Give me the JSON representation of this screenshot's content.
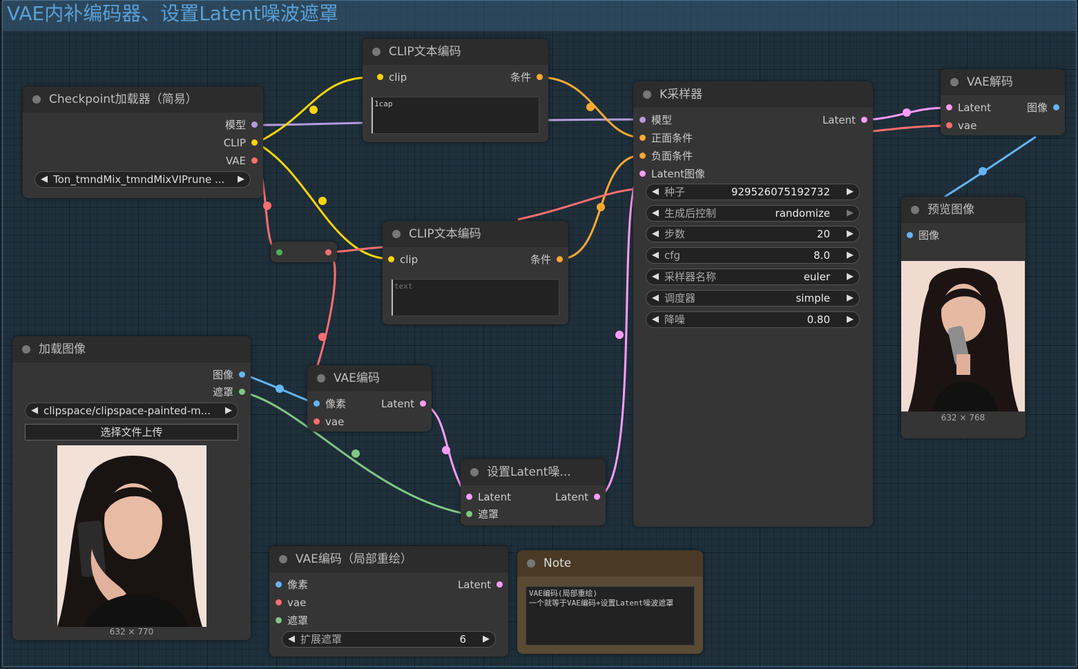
{
  "group": {
    "title": "VAE内补编码器、设置Latent噪波遮罩"
  },
  "colors": {
    "model": "#b39ddb",
    "clip": "#ffd500",
    "vae": "#ff6e6e",
    "conditioning": "#ffa931",
    "latent": "#ff9cf9",
    "image": "#64b5f6",
    "mask": "#81c784",
    "int": "#4caf50"
  },
  "checkpoint": {
    "title": "Checkpoint加载器（简易）",
    "outputs": [
      "模型",
      "CLIP",
      "VAE"
    ],
    "ckpt_value": "Ton_tmndMix_tmndMixVIPrune ..."
  },
  "clip1": {
    "title": "CLIP文本编码",
    "input": "clip",
    "output": "条件",
    "text": "1cap"
  },
  "clip2": {
    "title": "CLIP文本编码",
    "input": "clip",
    "output": "条件",
    "placeholder": "text"
  },
  "ksampler": {
    "title": "K采样器",
    "inputs": [
      "模型",
      "正面条件",
      "负面条件",
      "Latent图像"
    ],
    "output": "Latent",
    "widgets": [
      {
        "label": "种子",
        "value": "929526075192732"
      },
      {
        "label": "生成后控制",
        "value": "randomize"
      },
      {
        "label": "步数",
        "value": "20"
      },
      {
        "label": "cfg",
        "value": "8.0"
      },
      {
        "label": "采样器名称",
        "value": "euler"
      },
      {
        "label": "调度器",
        "value": "simple"
      },
      {
        "label": "降噪",
        "value": "0.80"
      }
    ]
  },
  "vaedecode": {
    "title": "VAE解码",
    "inputs": [
      "Latent",
      "vae"
    ],
    "output": "图像"
  },
  "preview": {
    "title": "预览图像",
    "input": "图像",
    "size": "632 × 768"
  },
  "loadimage": {
    "title": "加载图像",
    "outputs": [
      "图像",
      "遮罩"
    ],
    "file": "clipspace/clipspace-painted-m...",
    "upload": "选择文件上传",
    "size": "632 × 770"
  },
  "vaeencode": {
    "title": "VAE编码",
    "inputs": [
      "像素",
      "vae"
    ],
    "output": "Latent"
  },
  "setlatent": {
    "title": "设置Latent噪...",
    "inputs": [
      "Latent",
      "遮罩"
    ],
    "output": "Latent"
  },
  "vaeinpaint": {
    "title": "VAE编码（局部重绘）",
    "inputs": [
      "像素",
      "vae",
      "遮罩"
    ],
    "output": "Latent",
    "widget": {
      "label": "扩展遮罩",
      "value": "6"
    }
  },
  "note": {
    "title": "Note",
    "text": "VAE编码(局部重绘)\n一个就等于VAE编码+设置Latent噪波遮罩"
  }
}
